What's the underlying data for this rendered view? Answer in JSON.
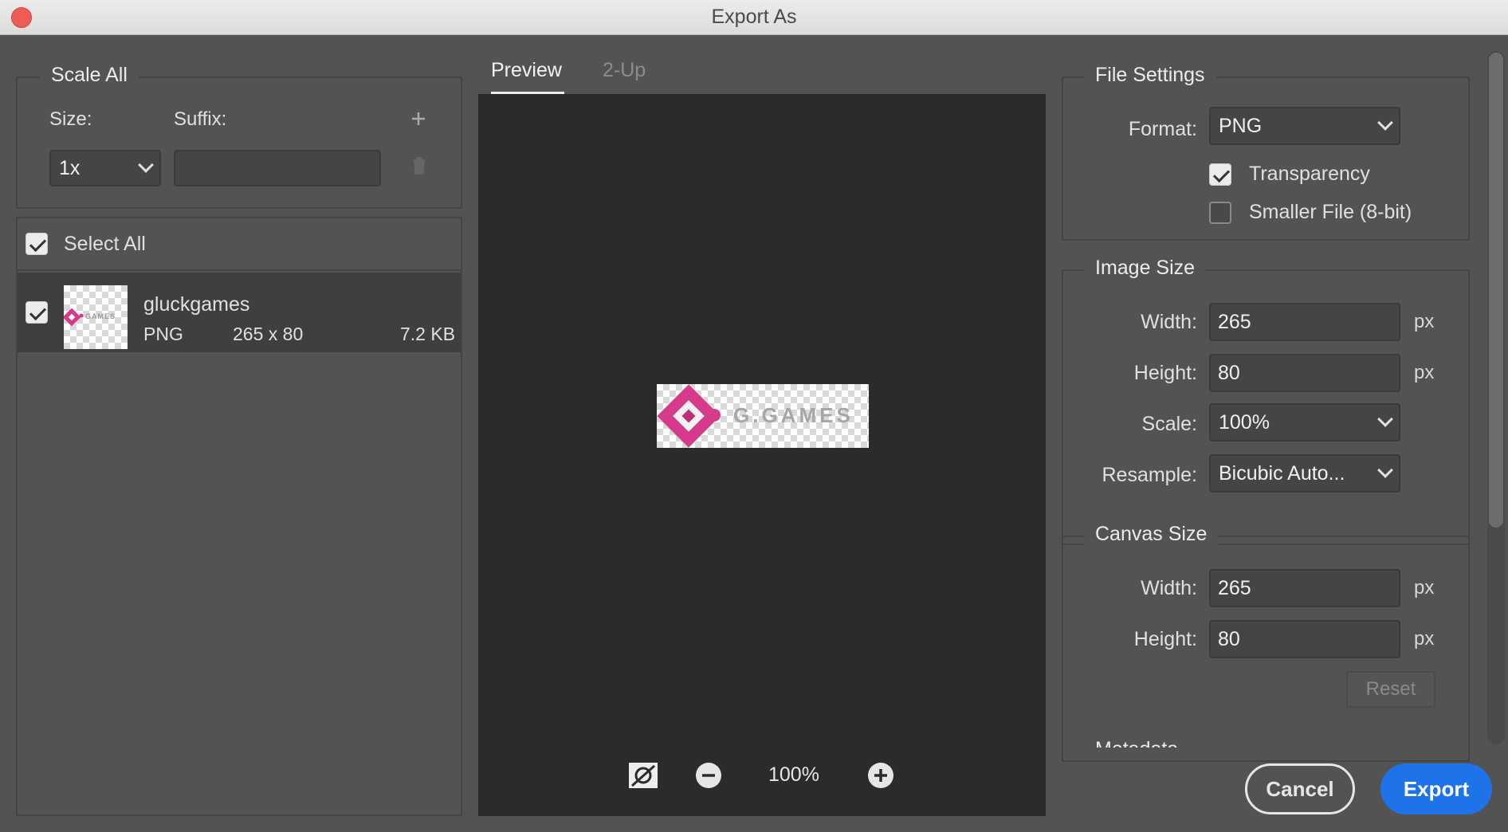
{
  "window": {
    "title": "Export As"
  },
  "scale_all": {
    "legend": "Scale All",
    "size_label": "Size:",
    "suffix_label": "Suffix:",
    "size_value": "1x",
    "suffix_value": "",
    "add_icon": "plus-icon",
    "delete_icon": "trash-icon"
  },
  "assets": {
    "select_all_label": "Select All",
    "select_all_checked": true,
    "items": [
      {
        "name": "gluckgames",
        "format": "PNG",
        "dimensions": "265 x 80",
        "size": "7.2 KB",
        "checked": true
      }
    ]
  },
  "preview": {
    "tabs": [
      {
        "label": "Preview",
        "active": true
      },
      {
        "label": "2-Up",
        "active": false
      }
    ],
    "logo_text": "G.GAMES",
    "zoom": "100%"
  },
  "file_settings": {
    "legend": "File Settings",
    "format_label": "Format:",
    "format_value": "PNG",
    "transparency_label": "Transparency",
    "transparency_checked": true,
    "smaller_file_label": "Smaller File (8-bit)",
    "smaller_file_checked": false
  },
  "image_size": {
    "legend": "Image Size",
    "width_label": "Width:",
    "width_value": "265",
    "height_label": "Height:",
    "height_value": "80",
    "scale_label": "Scale:",
    "scale_value": "100%",
    "resample_label": "Resample:",
    "resample_value": "Bicubic Auto...",
    "unit": "px"
  },
  "canvas_size": {
    "legend": "Canvas Size",
    "width_label": "Width:",
    "width_value": "265",
    "height_label": "Height:",
    "height_value": "80",
    "unit": "px",
    "reset_label": "Reset"
  },
  "metadata": {
    "legend": "Metadata"
  },
  "actions": {
    "cancel_label": "Cancel",
    "export_label": "Export"
  },
  "colors": {
    "accent": "#1f73e8",
    "logo_pink": "#d63a8a",
    "panel": "#535353",
    "preview_bg": "#2b2b2b"
  }
}
